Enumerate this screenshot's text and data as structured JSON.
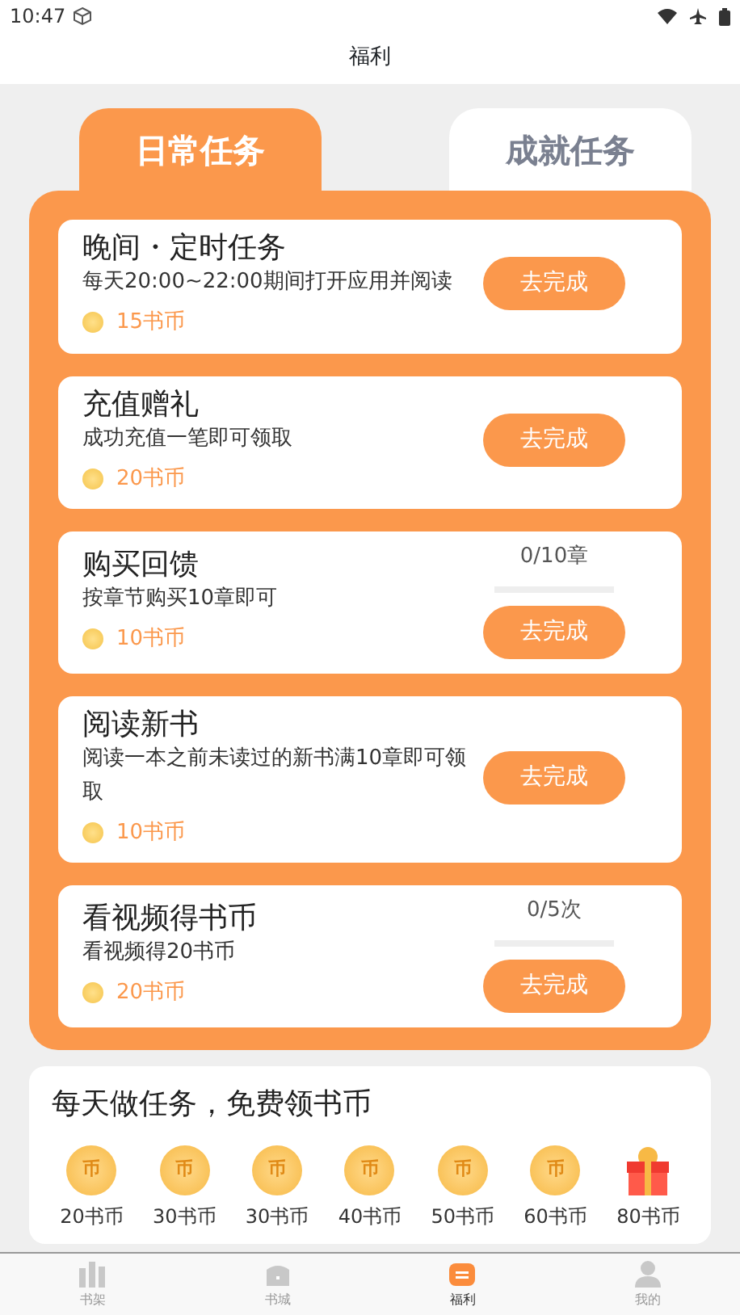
{
  "status_bar": {
    "time": "10:47"
  },
  "header": {
    "title": "福利"
  },
  "tabs": [
    {
      "label": "日常任务",
      "selected": true
    },
    {
      "label": "成就任务",
      "selected": false
    }
  ],
  "tasks": [
    {
      "title": "晚间・定时任务",
      "description": "每天20:00~22:00期间打开应用并阅读",
      "reward": "15书币",
      "button": "去完成"
    },
    {
      "title": "充值赠礼",
      "description": "成功充值一笔即可领取",
      "reward": "20书币",
      "button": "去完成"
    },
    {
      "title": "购买回馈",
      "description": "按章节购买10章即可",
      "reward": "10书币",
      "progress": {
        "text": "0/10章",
        "level": 0
      },
      "button": "去完成"
    },
    {
      "title": "阅读新书",
      "description": "阅读一本之前未读过的新书满10章即可领取",
      "reward": "10书币",
      "button": "去完成"
    },
    {
      "title": "看视频得书币",
      "description": "看视频得20书币",
      "reward": "20书币",
      "progress": {
        "text": "0/5次",
        "level": 0
      },
      "button": "去完成"
    }
  ],
  "milestones": {
    "title": "每天做任务，免费领书币",
    "items": [
      {
        "kind": "coin",
        "glyph": "币",
        "label": "20书币"
      },
      {
        "kind": "coin",
        "glyph": "币",
        "label": "30书币"
      },
      {
        "kind": "coin",
        "glyph": "币",
        "label": "30书币"
      },
      {
        "kind": "coin",
        "glyph": "币",
        "label": "40书币"
      },
      {
        "kind": "coin",
        "glyph": "币",
        "label": "50书币"
      },
      {
        "kind": "coin",
        "glyph": "币",
        "label": "60书币"
      },
      {
        "kind": "gift",
        "label": "80书币"
      }
    ]
  },
  "bottom_nav": [
    {
      "kind": "shelf",
      "label": "书架",
      "selected": false
    },
    {
      "kind": "store",
      "label": "书城",
      "selected": false
    },
    {
      "kind": "welfare",
      "label": "福利",
      "selected": true
    },
    {
      "kind": "profile",
      "label": "我的",
      "selected": false
    }
  ]
}
